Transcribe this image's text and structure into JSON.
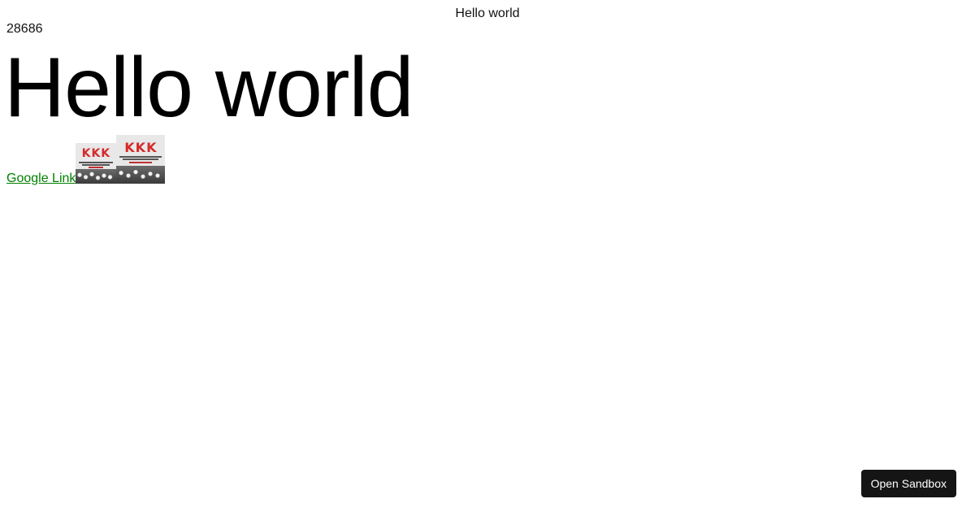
{
  "header": {
    "title": "Hello world"
  },
  "counter": {
    "value": "28686"
  },
  "main": {
    "heading": "Hello world",
    "link_label": "Google Link",
    "images": [
      {
        "name": "book-cover-kkk",
        "title": "KKK"
      },
      {
        "name": "book-cover-kkk",
        "title": "KKK"
      }
    ]
  },
  "sandbox": {
    "button_label": "Open Sandbox"
  },
  "colors": {
    "link": "#008000",
    "button_bg": "#151515",
    "button_text": "#ffffff",
    "cover_title": "#d42a2a"
  }
}
